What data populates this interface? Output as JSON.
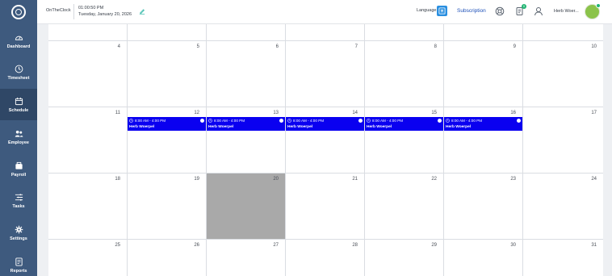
{
  "app": {
    "brand": "OnTheClock",
    "time": "01:00:50 PM",
    "date": "Tuesday, January 20, 2026"
  },
  "header": {
    "language_label": "Language",
    "subscription_label": "Subscription",
    "notification_count": "0",
    "user_name": "Herb Woer..."
  },
  "sidebar": {
    "items": [
      {
        "label": "Dashboard",
        "icon": "gauge-icon"
      },
      {
        "label": "Timesheet",
        "icon": "clock-icon"
      },
      {
        "label": "Schedule",
        "icon": "calendar-icon",
        "active": true
      },
      {
        "label": "Employee",
        "icon": "people-icon"
      },
      {
        "label": "Payroll",
        "icon": "wallet-icon"
      },
      {
        "label": "Tasks",
        "icon": "tasks-icon"
      },
      {
        "label": "Settings",
        "icon": "gear-icon"
      },
      {
        "label": "Reports",
        "icon": "report-icon"
      }
    ]
  },
  "calendar": {
    "weeks": [
      {
        "days": [
          "4",
          "5",
          "6",
          "7",
          "8",
          "9",
          "10"
        ]
      },
      {
        "days": [
          "11",
          "12",
          "13",
          "14",
          "15",
          "16",
          "17"
        ]
      },
      {
        "days": [
          "18",
          "19",
          "20",
          "21",
          "22",
          "23",
          "24"
        ]
      },
      {
        "days": [
          "25",
          "26",
          "27",
          "28",
          "29",
          "30",
          "31"
        ]
      }
    ],
    "today": "20",
    "events": [
      {
        "day": "12",
        "time": "8:00 AM - 4:00 PM",
        "name": "Herb Woerpel"
      },
      {
        "day": "13",
        "time": "8:00 AM - 4:00 PM",
        "name": "Herb Woerpel"
      },
      {
        "day": "14",
        "time": "8:00 AM - 4:00 PM",
        "name": "Herb Woerpel"
      },
      {
        "day": "15",
        "time": "8:00 AM - 4:00 PM",
        "name": "Herb Woerpel"
      },
      {
        "day": "16",
        "time": "8:00 AM - 4:00 PM",
        "name": "Herb Woerpel"
      }
    ]
  },
  "colors": {
    "sidebar": "#3e5a7e",
    "event": "#0a00f0",
    "today": "#a9a9a9",
    "accent": "#1c4fb8"
  }
}
